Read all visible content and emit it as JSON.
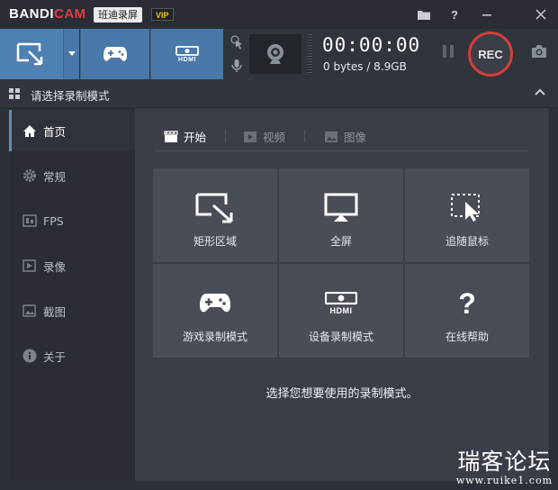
{
  "app": {
    "logo_main": "BANDI",
    "logo_accent": "CAM",
    "cn_name": "班迪录屏",
    "vip": "VIP"
  },
  "titlebar_icons": [
    "folder-icon",
    "help-icon",
    "minimize-icon",
    "close-icon"
  ],
  "toolbar": {
    "hdmi_label": "HDMI",
    "timer": "00:00:00",
    "size": "0 bytes / 8.9GB",
    "rec_label": "REC"
  },
  "header": {
    "title": "请选择录制模式"
  },
  "sidebar": {
    "items": [
      {
        "label": "首页",
        "icon": "home-icon"
      },
      {
        "label": "常规",
        "icon": "gear-icon"
      },
      {
        "label": "FPS",
        "icon": "fps-icon"
      },
      {
        "label": "录像",
        "icon": "video-icon"
      },
      {
        "label": "截图",
        "icon": "image-icon"
      },
      {
        "label": "关于",
        "icon": "info-icon"
      }
    ]
  },
  "tabs": [
    {
      "label": "开始",
      "icon": "clapper-icon"
    },
    {
      "label": "视频",
      "icon": "play-icon"
    },
    {
      "label": "图像",
      "icon": "picture-icon"
    }
  ],
  "tiles": [
    {
      "label": "矩形区域",
      "icon": "rectangle-area-icon"
    },
    {
      "label": "全屏",
      "icon": "monitor-icon"
    },
    {
      "label": "追随鼠标",
      "icon": "follow-mouse-icon"
    },
    {
      "label": "游戏录制模式",
      "icon": "gamepad-icon"
    },
    {
      "label": "设备录制模式",
      "icon": "hdmi-device-icon"
    },
    {
      "label": "在线帮助",
      "icon": "question-icon"
    }
  ],
  "hint": "选择您想要使用的录制模式。",
  "watermark": {
    "line1": "瑞客论坛",
    "line2": "www.ruike1.com"
  },
  "colors": {
    "accent_blue": "#4f80b2",
    "rec_red": "#d83c3c",
    "vip_yellow": "#f2c40f"
  }
}
